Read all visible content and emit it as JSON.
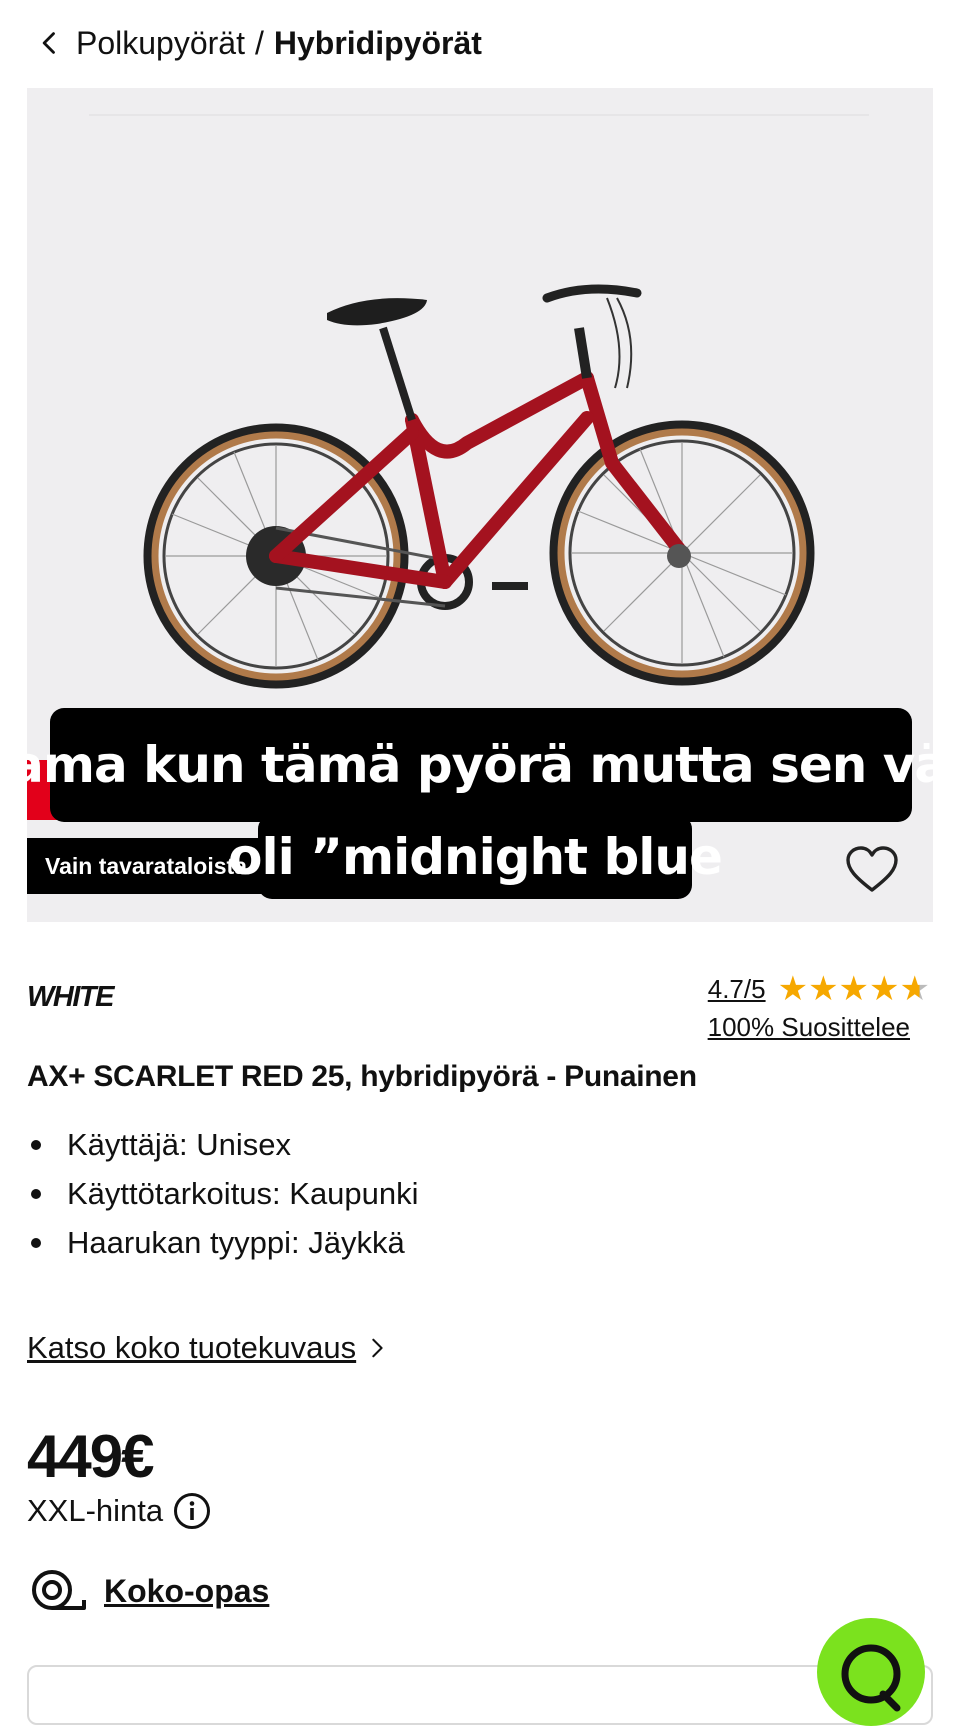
{
  "breadcrumb": {
    "parent": "Polkupyörät",
    "separator": "/",
    "current": "Hybridipyörät"
  },
  "hero": {
    "store_badge": "Vain tavarataloista",
    "caption_line1": "Sama kun tämä pyörä mutta sen väri",
    "caption_line2": "oli ”midnight blue"
  },
  "product": {
    "brand": "WHITE",
    "rating_score": "4.7/5",
    "rating_value": 4.7,
    "rating_max": 5,
    "recommend": "100% Suosittelee",
    "title": "AX+ SCARLET RED 25, hybridipyörä - Punainen",
    "specs": [
      "Käyttäjä: Unisex",
      "Käyttötarkoitus: Kaupunki",
      "Haarukan tyyppi: Jäykkä"
    ],
    "desc_link": "Katso koko tuotekuvaus",
    "price": "449€",
    "price_label": "XXL-hinta",
    "size_guide": "Koko-opas"
  },
  "colors": {
    "accent_red": "#e2001a",
    "star": "#f6a800",
    "chat_green": "#7be21e",
    "bike_frame": "#a4121f"
  },
  "icons": {
    "back": "chevron-left-icon",
    "favorite": "heart-icon",
    "info": "info-icon",
    "size_guide": "measuring-tape-icon",
    "chat": "chat-bubble-icon"
  }
}
